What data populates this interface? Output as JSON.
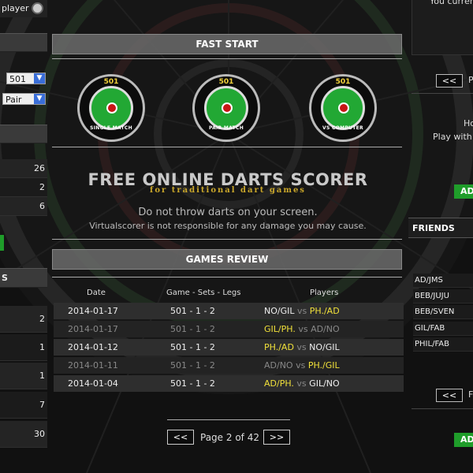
{
  "left": {
    "top_label": "player",
    "game_select": "501",
    "mode_select": "Pair",
    "stats": [
      "26",
      "2",
      "6"
    ],
    "section_label": "S",
    "list_counts": [
      "2",
      "1",
      "1",
      "7",
      "30"
    ]
  },
  "center": {
    "fast_start_title": "FAST START",
    "modes": [
      {
        "number": "501",
        "caption": "SINGLE MATCH"
      },
      {
        "number": "501",
        "caption": "PAIR MATCH"
      },
      {
        "number": "501",
        "caption": "VS COMPUTER"
      }
    ],
    "headline": "FREE ONLINE DARTS SCORER",
    "subheadline": "for traditional dart games",
    "warning_1": "Do not throw darts on your screen.",
    "warning_2": "Virtualscorer is not responsible for any damage you may cause.",
    "games_review_title": "GAMES REVIEW",
    "columns": [
      "Date",
      "Game - Sets - Legs",
      "Players"
    ],
    "rows": [
      {
        "date": "2014-01-17",
        "game": "501 - 1 - 2",
        "p1": "NO/GIL",
        "vs": "vs",
        "p2": "PH./AD"
      },
      {
        "date": "2014-01-17",
        "game": "501 - 1 - 2",
        "p1": "GIL/PH.",
        "vs": "vs",
        "p2": "AD/NO"
      },
      {
        "date": "2014-01-12",
        "game": "501 - 1 - 2",
        "p1": "PH./AD",
        "vs": "vs",
        "p2": "NO/GIL"
      },
      {
        "date": "2014-01-11",
        "game": "501 - 1 - 2",
        "p1": "AD/NO",
        "vs": "vs",
        "p2": "PH./GIL"
      },
      {
        "date": "2014-01-04",
        "game": "501 - 1 - 2",
        "p1": "AD/PH.",
        "vs": "vs",
        "p2": "GIL/NO"
      }
    ],
    "pagination": {
      "prev": "<<",
      "text": "Page 2 of 42",
      "next": ">>"
    }
  },
  "right": {
    "top_text": "You curren",
    "nav_prev": "<<",
    "nav_letter": "P",
    "info_1": "Ho",
    "info_2": "Play with",
    "add_label": "AD",
    "friends_title": "FRIENDS",
    "friends": [
      "AD/JMS",
      "BEB/JUJU",
      "BEB/SVEN",
      "GIL/FAB",
      "PHIL/FAB"
    ],
    "nav2_prev": "<<",
    "nav2_letter": "F",
    "add2_label": "AD"
  },
  "colors": {
    "green": "#22a834",
    "yellow": "#f0e03a",
    "section": "#6e6e6e"
  }
}
